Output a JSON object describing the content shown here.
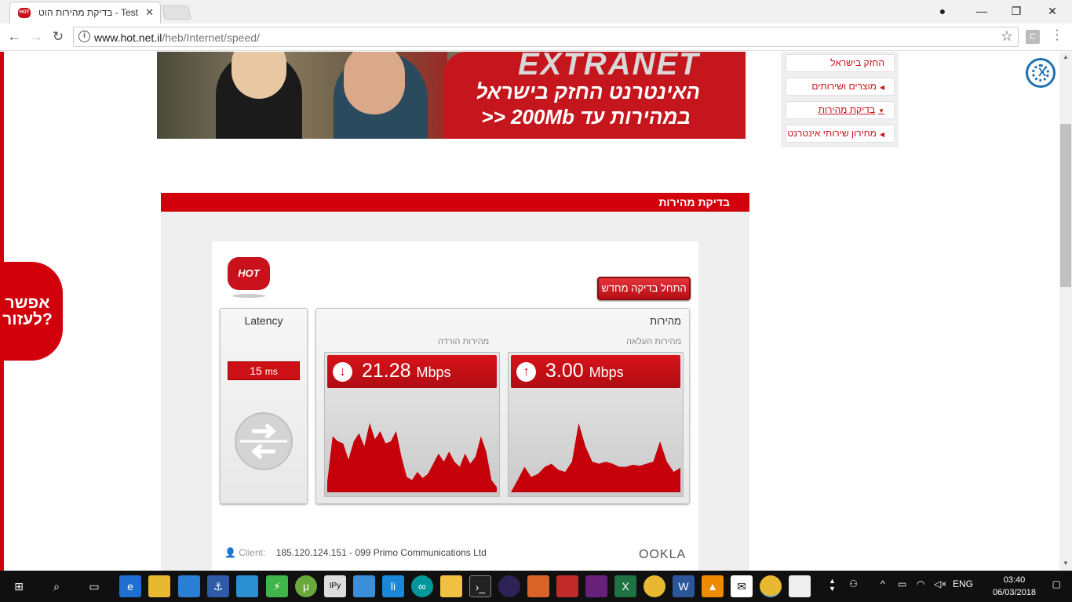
{
  "browser": {
    "tab_title": "בדיקת מהירות הוט - Test",
    "tab_favicon": "HOT",
    "url_domain": "www.hot.net.il",
    "url_path": "/heb/Internet/speed/",
    "extension_letter": "C"
  },
  "banner": {
    "brand": "EXTRANET",
    "line1": "האינטרנט החזק בישראל",
    "line2": "במהירות עד 200Mb <<"
  },
  "sidenav": {
    "items": [
      {
        "label": "החזק בישראל"
      },
      {
        "label": "מוצרים ושירותים"
      },
      {
        "label": "בדיקת מהירות"
      },
      {
        "label": "מחירון שירותי אינטרנט"
      }
    ]
  },
  "help_tab": {
    "line1": "אפשר",
    "line2": "לעזור?"
  },
  "section": {
    "header": "בדיקת מהירות"
  },
  "speedtest": {
    "logo": "HOT",
    "restart_label": "התחל בדיקה מחדש",
    "latency_label": "Latency",
    "latency_value": "15",
    "latency_unit": "ms",
    "speed_title": "מהירות",
    "upload_label": "מהירות העלאה",
    "download_label": "מהירות הורדה",
    "download_value": "21.28",
    "download_unit": "Mbps",
    "upload_value": "3.00",
    "upload_unit": "Mbps",
    "client_label": "Client:",
    "client_value": "185.120.124.151 - 099 Primo Communications Ltd",
    "ookla": "OOKLA"
  },
  "chart_data": [
    {
      "type": "area",
      "title": "",
      "values": [
        0.1,
        0.55,
        0.5,
        0.48,
        0.32,
        0.5,
        0.58,
        0.45,
        0.68,
        0.52,
        0.6,
        0.48,
        0.5,
        0.6,
        0.35,
        0.15,
        0.12,
        0.2,
        0.14,
        0.18,
        0.28,
        0.38,
        0.3,
        0.4,
        0.3,
        0.25,
        0.38,
        0.28,
        0.35,
        0.55,
        0.4,
        0.12,
        0.05
      ]
    },
    {
      "type": "area",
      "title": "",
      "values": [
        0.0,
        0.12,
        0.25,
        0.15,
        0.18,
        0.25,
        0.28,
        0.22,
        0.2,
        0.3,
        0.68,
        0.45,
        0.3,
        0.28,
        0.3,
        0.28,
        0.25,
        0.25,
        0.27,
        0.26,
        0.28,
        0.3,
        0.5,
        0.3,
        0.2,
        0.24
      ]
    }
  ],
  "taskbar": {
    "lang": "ENG",
    "time": "03:40",
    "date": "06/03/2018"
  }
}
